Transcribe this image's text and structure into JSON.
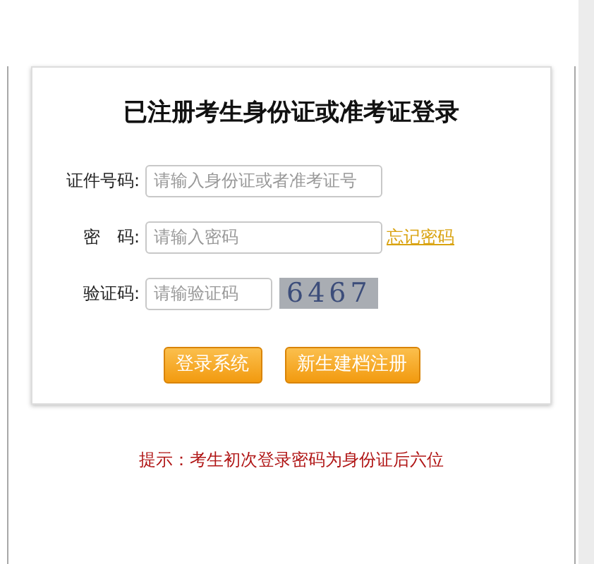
{
  "title": "已注册考生身份证或准考证登录",
  "fields": [
    {
      "kind": "id",
      "label": "证件号码:",
      "placeholder": "请输入身份证或者准考证号"
    },
    {
      "kind": "password",
      "label": "密　码:",
      "placeholder": "请输入密码",
      "link": "忘记密码"
    },
    {
      "kind": "captcha",
      "label": "验证码:",
      "placeholder": "请输验证码",
      "captcha": "6467"
    }
  ],
  "buttons": [
    "登录系统",
    "新生建档注册"
  ],
  "hint": "提示：考生初次登录密码为身份证后六位"
}
